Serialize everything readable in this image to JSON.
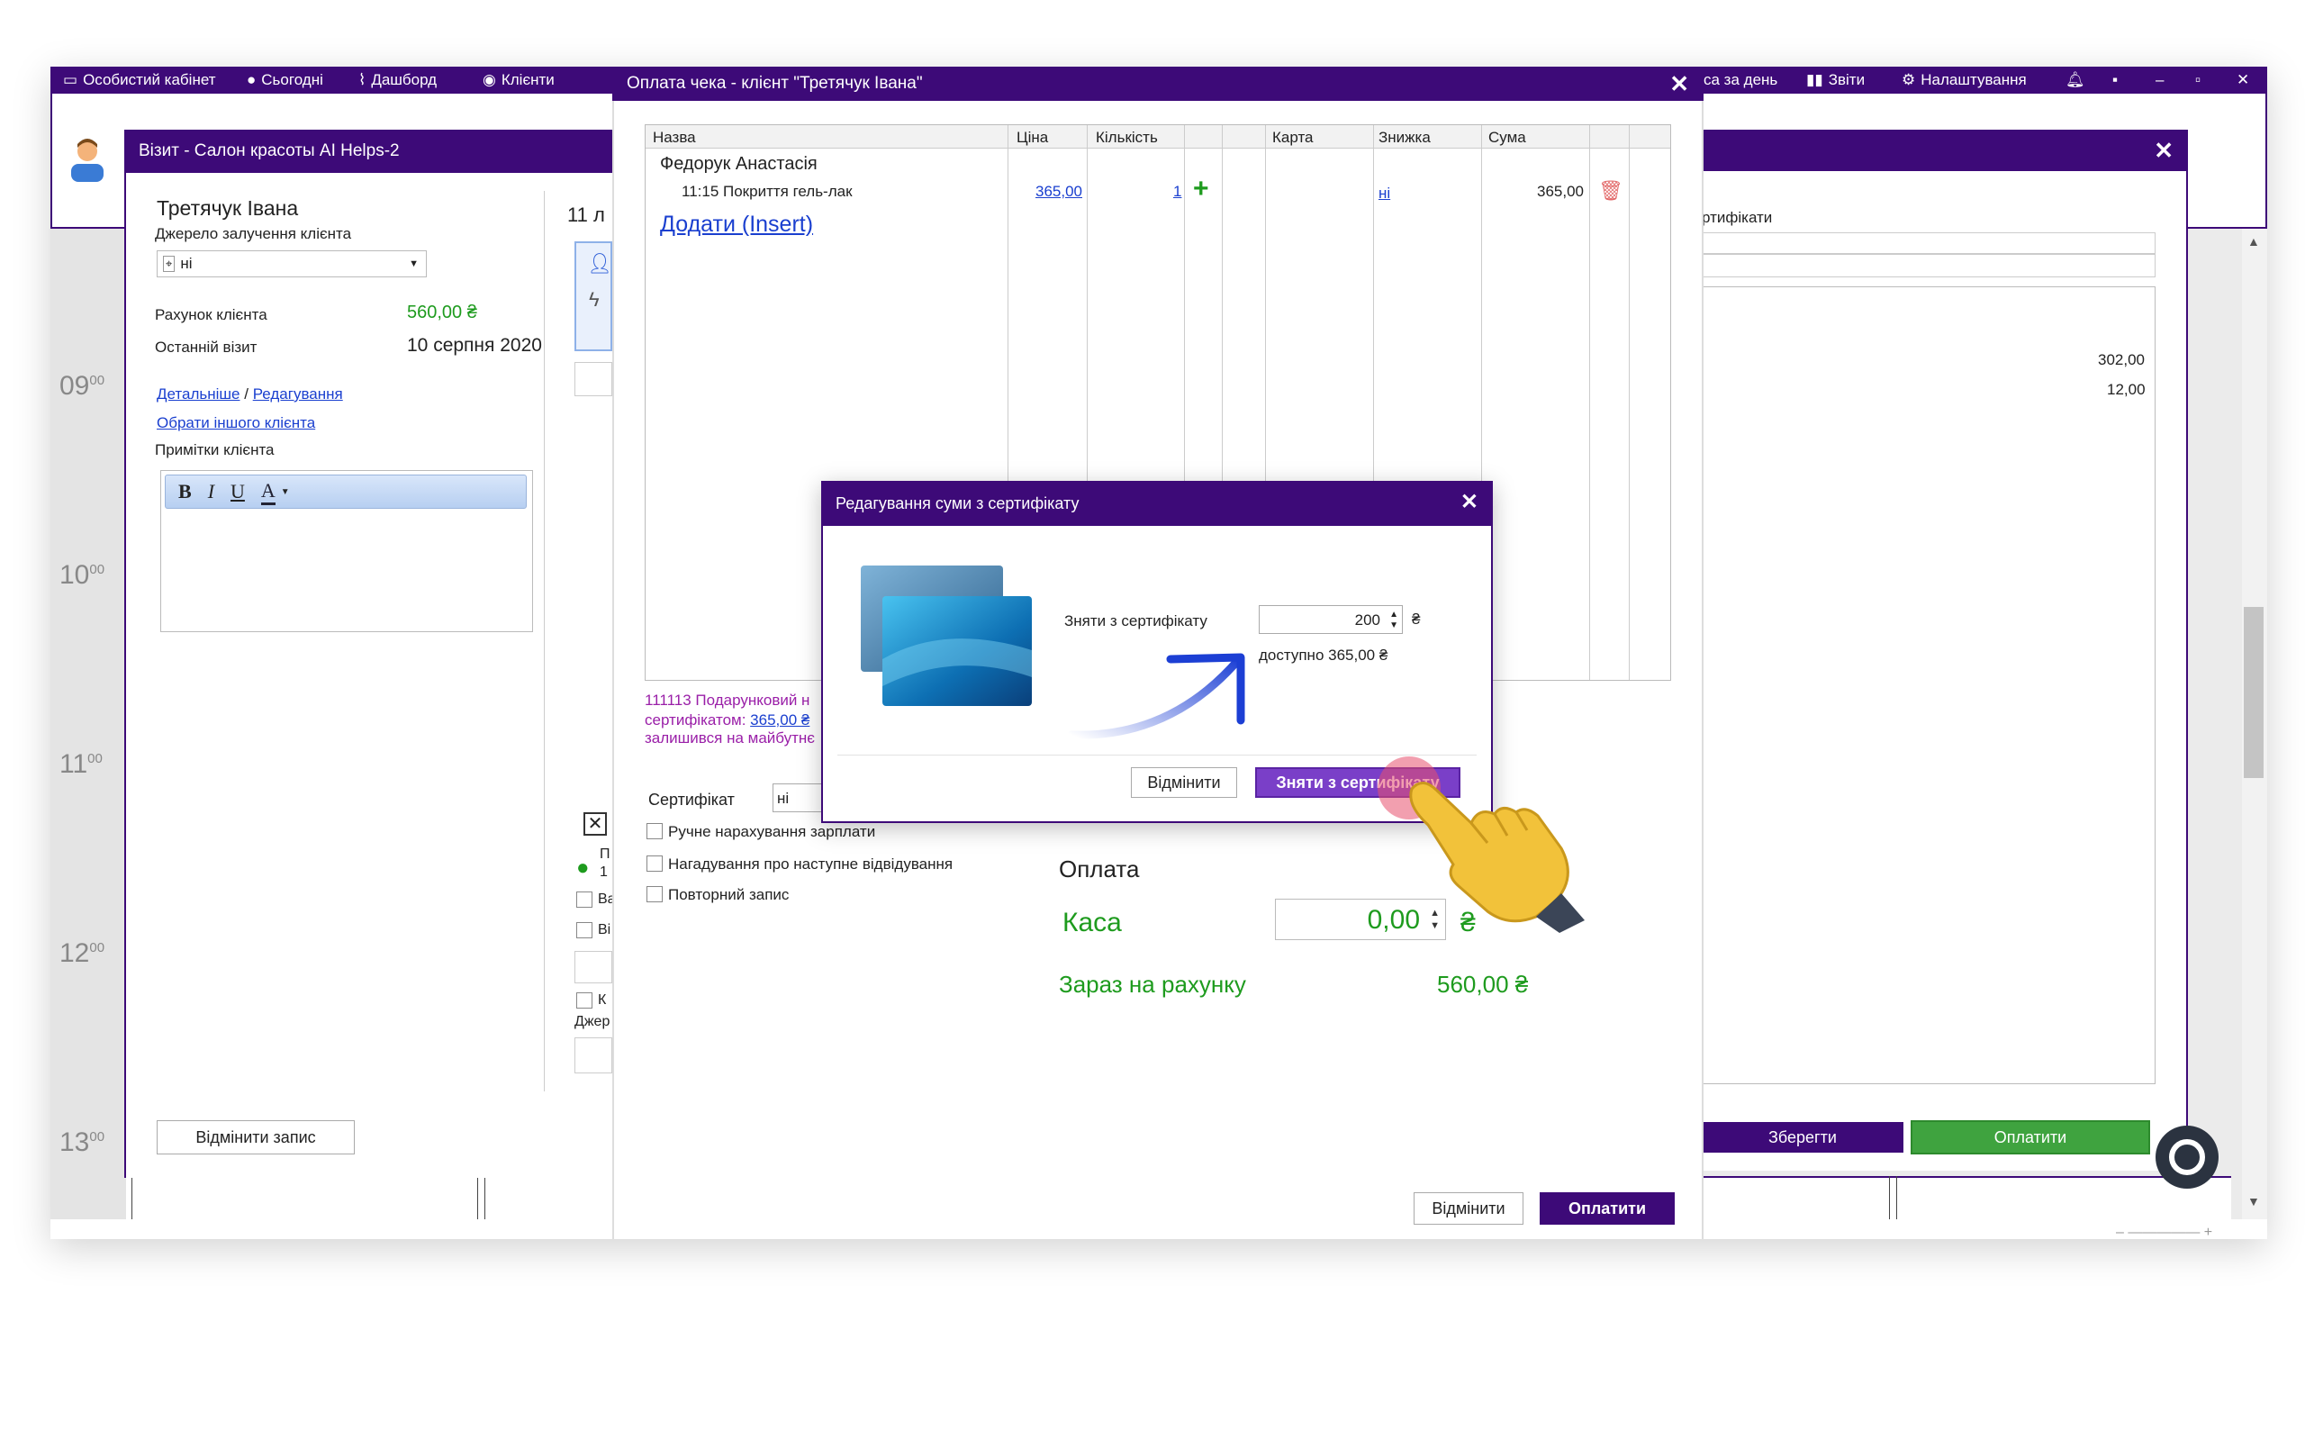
{
  "topnav": {
    "cabinet": "Особистий кабінет",
    "today": "Сьогодні",
    "dashboard": "Дашборд",
    "clients": "Клієнти",
    "cash_day": "са за день",
    "reports": "Звіти",
    "settings": "Налаштування"
  },
  "visit": {
    "title": "Візит - Салон красоты AI Helps-2",
    "client_name": "Третячук Івана",
    "source_label": "Джерело залучення клієнта",
    "source_value": "ні",
    "account_label": "Рахунок клієнта",
    "account_value": "560,00 ₴",
    "last_visit_label": "Останній візит",
    "last_visit_value": "10 серпня 2020",
    "details_link": "Детальніше",
    "slash": "/",
    "edit_link": "Редагування",
    "choose_other_link": "Обрати іншого клієнта",
    "notes_label": "Примітки клієнта",
    "date_partial": "11 л",
    "cancel_record": "Відмінити запис",
    "frag_p": "П",
    "frag_1": "1",
    "frag_va": "Ва",
    "frag_vi": "Ві",
    "frag_k": "К",
    "frag_dzher": "Джер"
  },
  "hours": [
    {
      "h": "09",
      "m": "00"
    },
    {
      "h": "10",
      "m": "00"
    },
    {
      "h": "11",
      "m": "00"
    },
    {
      "h": "12",
      "m": "00"
    },
    {
      "h": "13",
      "m": "00"
    }
  ],
  "payment": {
    "title": "Оплата чека - клієнт \"Третячук Івана\"",
    "columns": [
      "Назва",
      "Ціна",
      "Кількість",
      "",
      "Карта",
      "Знижка",
      "Сума"
    ],
    "master": "Федорук Анастасія",
    "service": "11:15 Покриття гель-лак",
    "price": "365,00",
    "qty": "1",
    "discount": "ні",
    "sum": "365,00",
    "add_link": "Додати (Insert)",
    "cert_note_1": "111113 Подарунковий н",
    "cert_note_2_pre": "сертифікатом: ",
    "cert_note_2_link": "365,00 ₴",
    "cert_note_3": "залишився на майбутнє",
    "certificate_label": "Сертифікат",
    "certificate_value": "ні",
    "manual_salary": "Ручне нарахування зарплати",
    "reminder": "Нагадування про наступне відвідування",
    "repeat": "Повторний запис",
    "pay_heading": "Оплата",
    "kasa_label": "Каса",
    "kasa_value": "0,00",
    "currency": "₴",
    "now_on_account_label": "Зараз на рахунку",
    "now_on_account_value": "560,00 ₴",
    "cancel": "Відмінити",
    "pay": "Оплатити"
  },
  "right_panel": {
    "certs_label": "ртифікати",
    "value1": "302,00",
    "value2": "12,00",
    "save": "Зберегти",
    "pay": "Оплатити"
  },
  "cert_dialog": {
    "title": "Редагування суми з сертифікату",
    "withdraw_label": "Зняти з сертифікату",
    "amount": "200",
    "currency": "₴",
    "available": "доступно 365,00 ₴",
    "cancel": "Відмінити",
    "confirm": "Зняти з сертифікату"
  },
  "colors": {
    "purple": "#3d0a78",
    "green_text": "#1e9b1e",
    "link": "#1a3fcf",
    "confirm_button": "#7a3fc8",
    "pay_green": "#3fa33f"
  }
}
